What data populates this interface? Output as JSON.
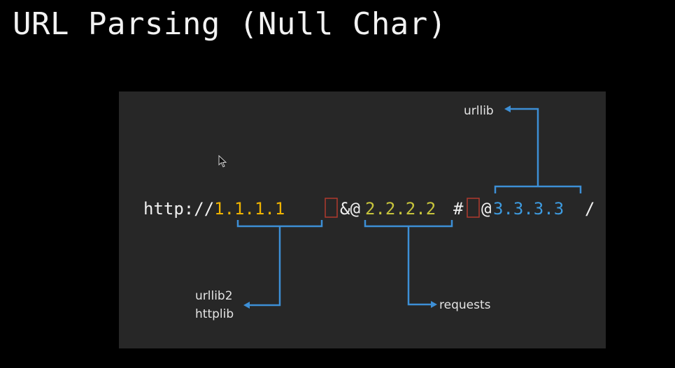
{
  "slide": {
    "title": "URL Parsing (Null Char)"
  },
  "url": {
    "scheme": "http://",
    "host1": "1.1.1.1",
    "sep1": "&@",
    "host2": "2.2.2.2",
    "sep2": "#",
    "sep3": "@",
    "host3": "3.3.3.3",
    "tail": "/"
  },
  "labels": {
    "urllib": "urllib",
    "urllib2": "urllib2",
    "httplib": "httplib",
    "requests": "requests"
  },
  "colors": {
    "background": "#000000",
    "panel": "#272727",
    "text": "#f0f0f0",
    "host1": "#f0b400",
    "host2": "#c7c43c",
    "host3": "#3d9be0",
    "arrow": "#3d8fd6",
    "null_box": "#c0392b"
  }
}
